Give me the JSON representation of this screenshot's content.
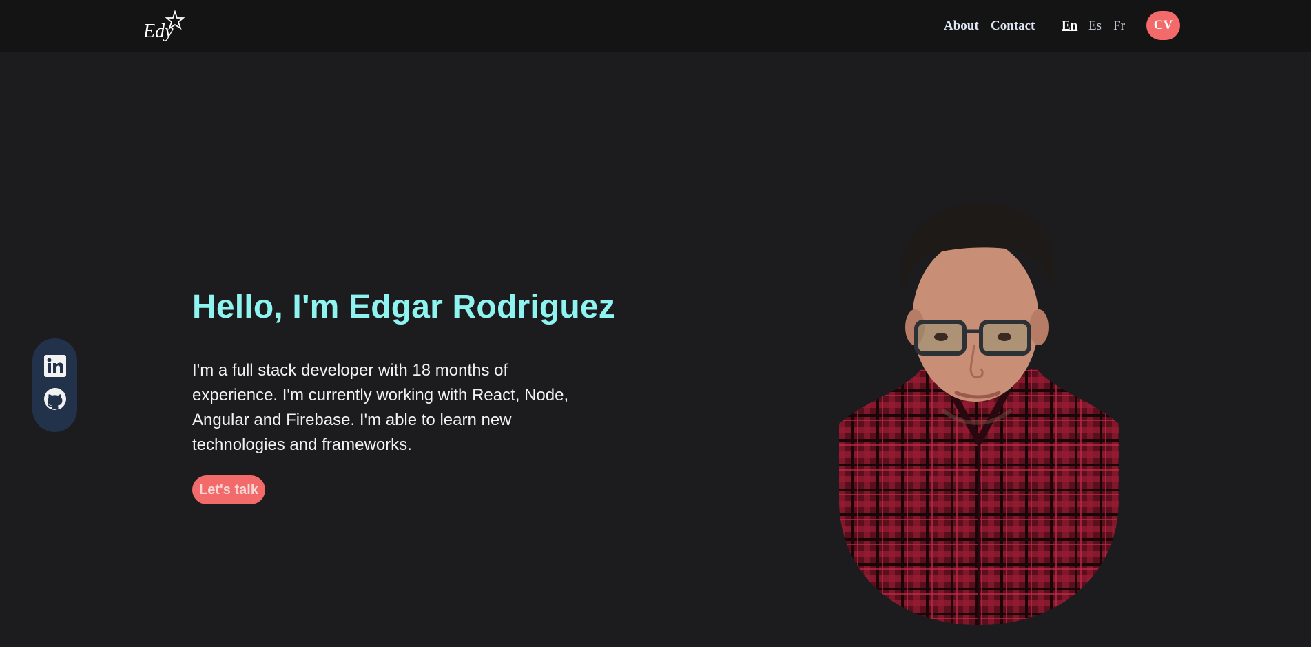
{
  "header": {
    "logo_text": "Edy",
    "nav": {
      "about": "About",
      "contact": "Contact"
    },
    "languages": {
      "en": "En",
      "es": "Es",
      "fr": "Fr",
      "active": "En"
    },
    "cv_label": "CV"
  },
  "social": {
    "items": [
      "linkedin-icon",
      "github-icon"
    ]
  },
  "hero": {
    "headline": "Hello, I'm Edgar Rodriguez",
    "intro": "I'm a full stack developer with 18 months of experience. I'm currently working with React, Node, Angular and Firebase. I'm able to learn new technologies and frameworks.",
    "cta": "Let's talk"
  },
  "colors": {
    "accent": "#f36a6a",
    "headline": "#8ff3f0",
    "background": "#1c1c1e",
    "topbar": "#141414",
    "social_bg": "#22324a"
  }
}
